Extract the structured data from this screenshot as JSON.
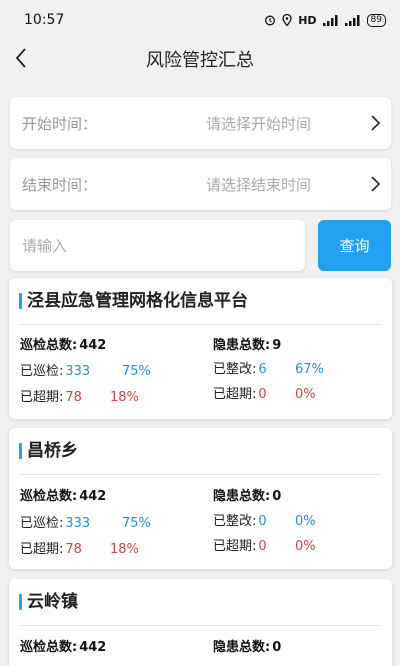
{
  "status_bar": {
    "time": "10:57",
    "network": "HD",
    "battery": "89"
  },
  "header": {
    "title": "风险管控汇总"
  },
  "filters": {
    "start": {
      "label": "开始时间：",
      "placeholder": "请选择开始时间"
    },
    "end": {
      "label": "结束时间：",
      "placeholder": "请选择结束时间"
    }
  },
  "search": {
    "placeholder": "请输入",
    "button_label": "查询"
  },
  "colors": {
    "accent": "#21a1ef",
    "blue_value": "#2a8fce",
    "red_value": "#c0484e"
  },
  "cards": [
    {
      "title": "泾县应急管理网格化信息平台",
      "patrol_total_label": "巡检总数:",
      "patrol_total": "442",
      "patrol_done_label": "已巡检:",
      "patrol_done": "333",
      "patrol_done_pct": "75%",
      "patrol_overdue_label": "已超期:",
      "patrol_overdue": "78",
      "patrol_overdue_pct": "18%",
      "hazard_total_label": "隐患总数:",
      "hazard_total": "9",
      "hazard_fixed_label": "已整改:",
      "hazard_fixed": "6",
      "hazard_fixed_pct": "67%",
      "hazard_overdue_label": "已超期:",
      "hazard_overdue": "0",
      "hazard_overdue_pct": "0%"
    },
    {
      "title": "昌桥乡",
      "patrol_total_label": "巡检总数:",
      "patrol_total": "442",
      "patrol_done_label": "已巡检:",
      "patrol_done": "333",
      "patrol_done_pct": "75%",
      "patrol_overdue_label": "已超期:",
      "patrol_overdue": "78",
      "patrol_overdue_pct": "18%",
      "hazard_total_label": "隐患总数:",
      "hazard_total": "0",
      "hazard_fixed_label": "已整改:",
      "hazard_fixed": "0",
      "hazard_fixed_pct": "0%",
      "hazard_overdue_label": "已超期:",
      "hazard_overdue": "0",
      "hazard_overdue_pct": "0%"
    },
    {
      "title": "云岭镇",
      "patrol_total_label": "巡检总数:",
      "patrol_total": "442",
      "hazard_total_label": "隐患总数:",
      "hazard_total": "0"
    }
  ]
}
